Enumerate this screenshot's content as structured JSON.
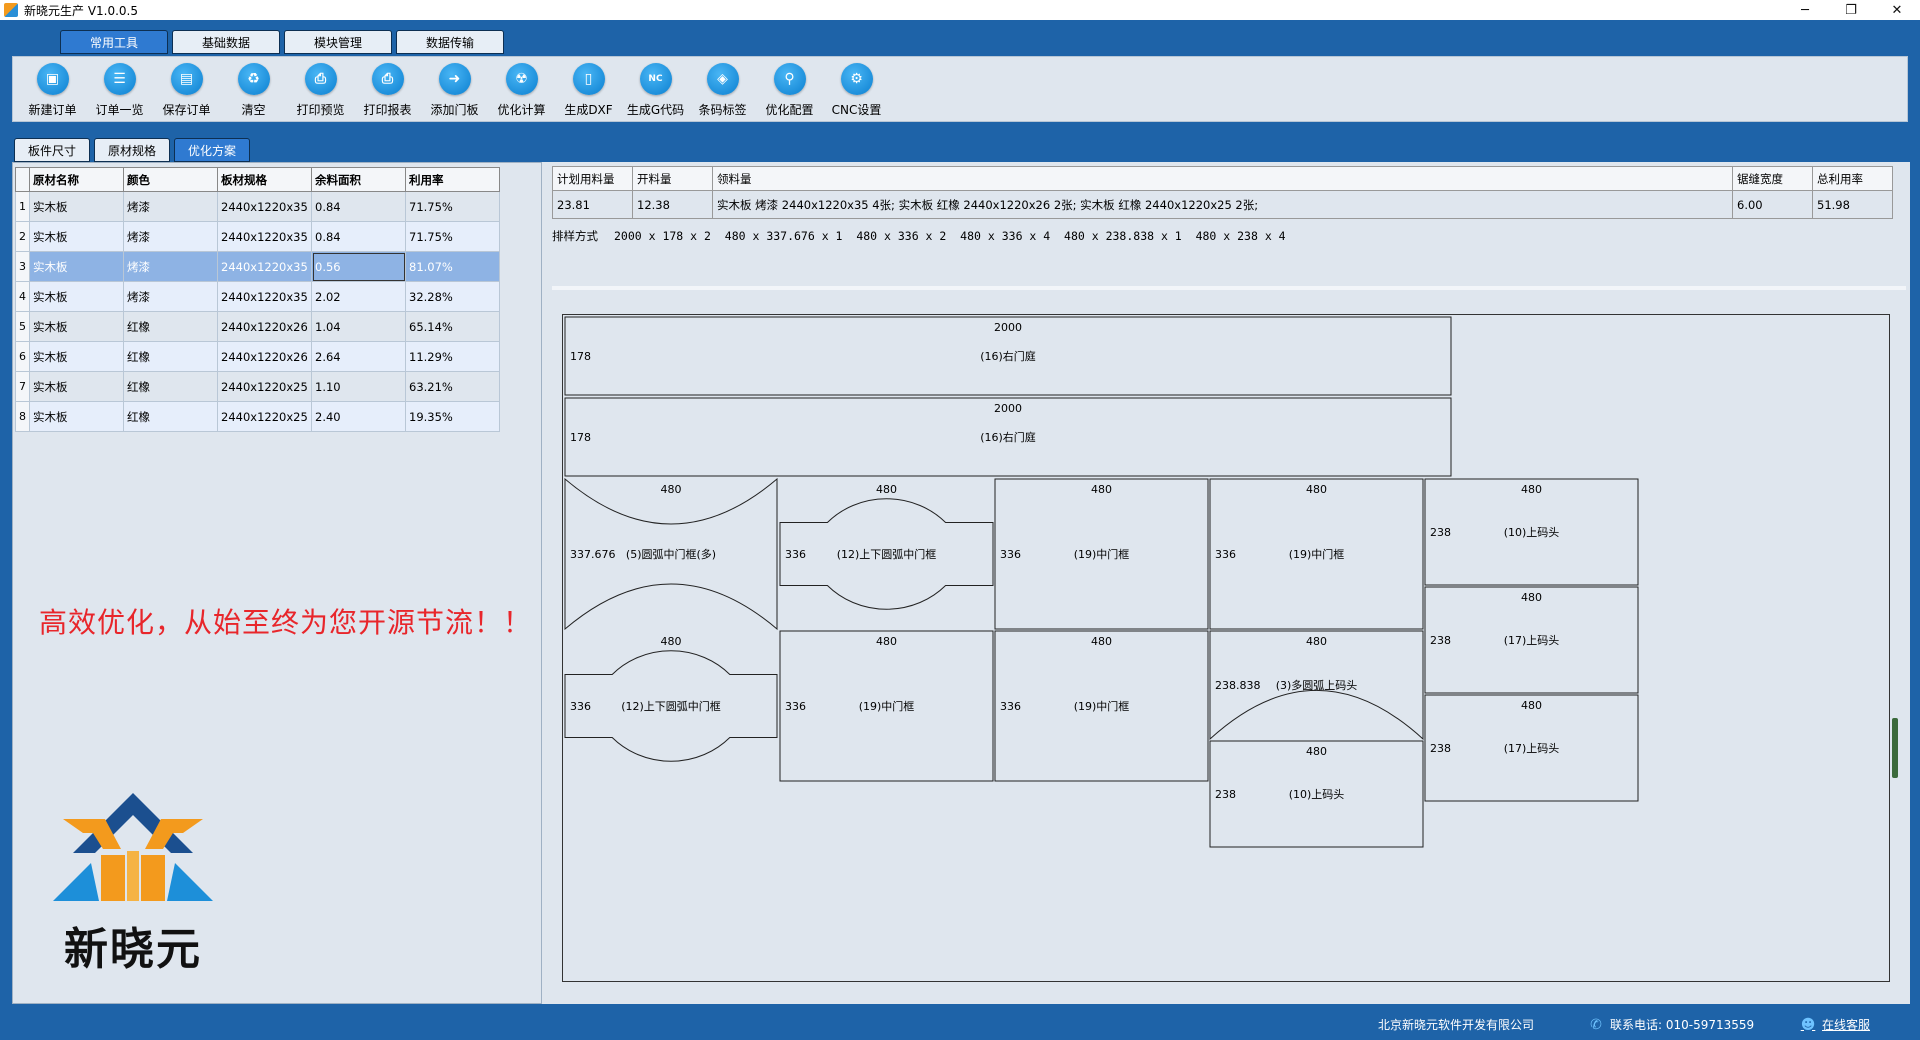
{
  "window": {
    "title": "新晓元生产 V1.0.0.5",
    "controls": [
      "─",
      "❐",
      "✕"
    ]
  },
  "top_tabs": [
    {
      "label": "常用工具",
      "active": true
    },
    {
      "label": "基础数据",
      "active": false
    },
    {
      "label": "模块管理",
      "active": false
    },
    {
      "label": "数据传输",
      "active": false
    }
  ],
  "toolbar": [
    {
      "label": "新建订单",
      "icon": "new-order-icon",
      "glyph": "▣"
    },
    {
      "label": "订单一览",
      "icon": "order-list-icon",
      "glyph": "☰"
    },
    {
      "label": "保存订单",
      "icon": "save-icon",
      "glyph": "▤"
    },
    {
      "label": "清空",
      "icon": "trash-icon",
      "glyph": "♻"
    },
    {
      "label": "打印预览",
      "icon": "print-preview-icon",
      "glyph": "⎙"
    },
    {
      "label": "打印报表",
      "icon": "printer-icon",
      "glyph": "⎙"
    },
    {
      "label": "添加门板",
      "icon": "add-door-icon",
      "glyph": "➜"
    },
    {
      "label": "优化计算",
      "icon": "optimize-icon",
      "glyph": "☢"
    },
    {
      "label": "生成DXF",
      "icon": "dxf-file-icon",
      "glyph": "▯"
    },
    {
      "label": "生成G代码",
      "icon": "nc-code-icon",
      "glyph": "NC"
    },
    {
      "label": "条码标签",
      "icon": "barcode-tag-icon",
      "glyph": "◈"
    },
    {
      "label": "优化配置",
      "icon": "optimize-config-icon",
      "glyph": "⚲"
    },
    {
      "label": "CNC设置",
      "icon": "cnc-gear-icon",
      "glyph": "⚙"
    }
  ],
  "sub_tabs": [
    {
      "label": "板件尺寸",
      "active": false
    },
    {
      "label": "原材规格",
      "active": false
    },
    {
      "label": "优化方案",
      "active": true
    }
  ],
  "grid": {
    "headers": [
      "原材名称",
      "颜色",
      "板材规格",
      "余料面积",
      "利用率"
    ],
    "selected_row": 3,
    "rows": [
      {
        "num": "1",
        "name": "实木板",
        "color": "烤漆",
        "spec": "2440x1220x35",
        "remain": "0.84",
        "rate": "71.75%"
      },
      {
        "num": "2",
        "name": "实木板",
        "color": "烤漆",
        "spec": "2440x1220x35",
        "remain": "0.84",
        "rate": "71.75%"
      },
      {
        "num": "3",
        "name": "实木板",
        "color": "烤漆",
        "spec": "2440x1220x35",
        "remain": "0.56",
        "rate": "81.07%"
      },
      {
        "num": "4",
        "name": "实木板",
        "color": "烤漆",
        "spec": "2440x1220x35",
        "remain": "2.02",
        "rate": "32.28%"
      },
      {
        "num": "5",
        "name": "实木板",
        "color": "红橡",
        "spec": "2440x1220x26",
        "remain": "1.04",
        "rate": "65.14%"
      },
      {
        "num": "6",
        "name": "实木板",
        "color": "红橡",
        "spec": "2440x1220x26",
        "remain": "2.64",
        "rate": "11.29%"
      },
      {
        "num": "7",
        "name": "实木板",
        "color": "红橡",
        "spec": "2440x1220x25",
        "remain": "1.10",
        "rate": "63.21%"
      },
      {
        "num": "8",
        "name": "实木板",
        "color": "红橡",
        "spec": "2440x1220x25",
        "remain": "2.40",
        "rate": "19.35%"
      }
    ]
  },
  "slogan": "高效优化，从始至终为您开源节流！！",
  "logo": {
    "text": "新晓元",
    "colors": {
      "orange": "#f39a1d",
      "blue": "#1d8fd9",
      "navy": "#1b4f8f"
    }
  },
  "summary": {
    "headers": [
      "计划用料量",
      "开料量",
      "领料量",
      "锯缝宽度",
      "总利用率"
    ],
    "values": [
      "23.81",
      "12.38",
      "实木板 烤漆 2440x1220x35 4张; 实木板 红橡 2440x1220x26 2张; 实木板 红橡 2440x1220x25 2张;",
      "6.00",
      "51.98"
    ]
  },
  "sort": {
    "label": "排样方式",
    "value": "2000 x 178 x 2  480 x 337.676 x 1  480 x 336 x 2  480 x 336 x 4  480 x 238.838 x 1  480 x 238 x 4"
  },
  "layout_parts": [
    {
      "type": "rect",
      "width": "2000",
      "height": "178",
      "name": "(16)右门庭"
    },
    {
      "type": "rect",
      "width": "2000",
      "height": "178",
      "name": "(16)右门庭"
    },
    {
      "type": "arc-concave",
      "width": "480",
      "height": "337.676",
      "name": "(5)圆弧中门框(多)"
    },
    {
      "type": "arc-convex",
      "width": "480",
      "height": "336",
      "name": "(12)上下圆弧中门框"
    },
    {
      "type": "rect",
      "width": "480",
      "height": "336",
      "name": "(19)中门框"
    },
    {
      "type": "rect",
      "width": "480",
      "height": "336",
      "name": "(19)中门框"
    },
    {
      "type": "rect",
      "width": "480",
      "height": "238",
      "name": "(10)上码头"
    },
    {
      "type": "rect",
      "width": "480",
      "height": "238",
      "name": "(17)上码头"
    },
    {
      "type": "rect",
      "width": "480",
      "height": "238",
      "name": "(17)上码头"
    },
    {
      "type": "arc-convex",
      "width": "480",
      "height": "336",
      "name": "(12)上下圆弧中门框"
    },
    {
      "type": "rect",
      "width": "480",
      "height": "336",
      "name": "(19)中门框"
    },
    {
      "type": "rect",
      "width": "480",
      "height": "336",
      "name": "(19)中门框"
    },
    {
      "type": "arc-bottom",
      "width": "480",
      "height": "238.838",
      "name": "(3)多圆弧上码头"
    },
    {
      "type": "rect",
      "width": "480",
      "height": "238",
      "name": "(10)上码头"
    }
  ],
  "status": {
    "company": "北京新晓元软件开发有限公司",
    "phone": "联系电话: 010-59713559",
    "support": "在线客服"
  }
}
